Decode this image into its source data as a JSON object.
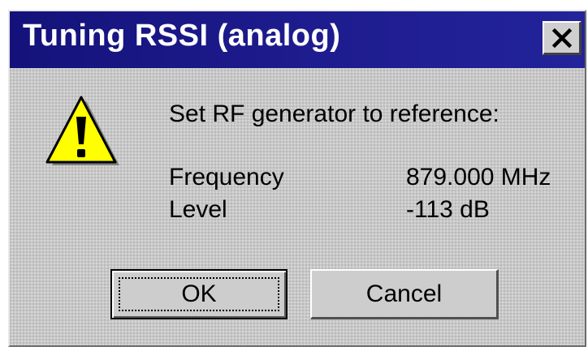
{
  "window": {
    "title": "Tuning RSSI (analog)"
  },
  "titlebar": {
    "close_icon": "close-icon",
    "color": "#1d1b8c"
  },
  "dialog": {
    "icon": "warning-icon",
    "message": "Set RF generator to reference:",
    "fields": [
      {
        "label": "Frequency",
        "value": "879.000 MHz"
      },
      {
        "label": "Level",
        "value": "-113 dB"
      }
    ]
  },
  "buttons": {
    "ok_label": "OK",
    "cancel_label": "Cancel"
  }
}
